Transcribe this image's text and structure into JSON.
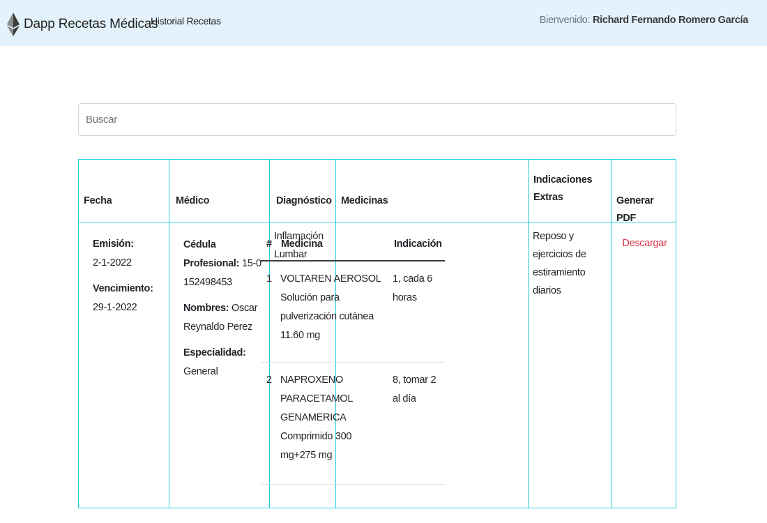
{
  "navbar": {
    "brand": "Dapp Recetas Médicas",
    "brand_icon": "ethereum-logo-icon",
    "history_link": "Historial Recetas",
    "welcome_label": "Bienvenido:",
    "user_name": "Richard Fernando Romero García"
  },
  "search": {
    "placeholder": "Buscar",
    "value": ""
  },
  "table": {
    "headers": {
      "fecha": "Fecha",
      "medico": "Médico",
      "diagnostico": "Diagnóstico",
      "medicinas": "Medicinas",
      "indicaciones_1": "Indicaciones",
      "indicaciones_2": "Extras",
      "pdf": "Generar PDF"
    },
    "rows": [
      {
        "emision_label": "Emisión:",
        "emision": "2-1-2022",
        "vencimiento_label": "Vencimiento:",
        "vencimiento": "29-1-2022",
        "cedula_label": "Cédula Profesional:",
        "cedula": "15-0152498453",
        "nombres_label": "Nombres:",
        "nombres": "Oscar Reynaldo Perez",
        "especialidad_label": "Especialidad:",
        "especialidad": "General",
        "diagnostico": "Inflamación Lumbar",
        "medicinas_headers": {
          "num": "#",
          "medicina": "Medicina",
          "indicacion": "Indicación"
        },
        "medicinas": [
          {
            "num": "1",
            "medicina": "VOLTAREN AEROSOL Solución para pulverización cutánea 11.60 mg",
            "indicacion": "1, cada 6 horas"
          },
          {
            "num": "2",
            "medicina": "NAPROXENO PARACETAMOL GENAMERICA Comprimido 300 mg+275 mg",
            "indicacion": "8, tomar 2 al día"
          }
        ],
        "indicaciones_extras": "Reposo y ejercicios de estiramiento diarios",
        "pdf_link": "Descargar"
      }
    ]
  }
}
